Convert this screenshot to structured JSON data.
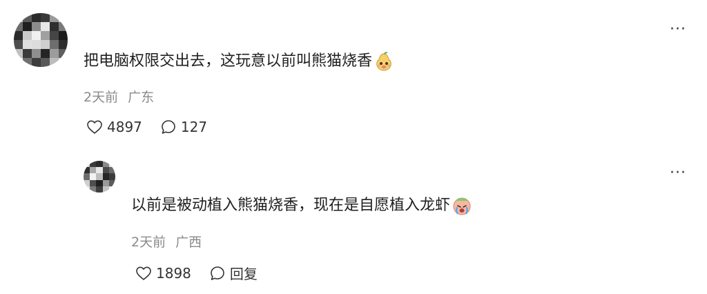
{
  "comment": {
    "text": "把电脑权限交出去，这玩意以前叫熊猫烧香",
    "emoji": "pear-face-emoji",
    "time": "2天前",
    "location": "广东",
    "likes": "4897",
    "replies": "127"
  },
  "reply": {
    "text": "以前是被动植入熊猫烧香，现在是自愿植入龙虾",
    "emoji": "crying-face-emoji",
    "time": "2天前",
    "location": "广西",
    "likes": "1898",
    "reply_label": "回复"
  },
  "icons": {
    "like": "heart-outline-icon",
    "comment": "speech-bubble-icon",
    "more": "ellipsis-icon"
  },
  "colors": {
    "text": "#1f1f1f",
    "meta": "#8a8a8a",
    "background": "#ffffff"
  },
  "more_label": "···"
}
